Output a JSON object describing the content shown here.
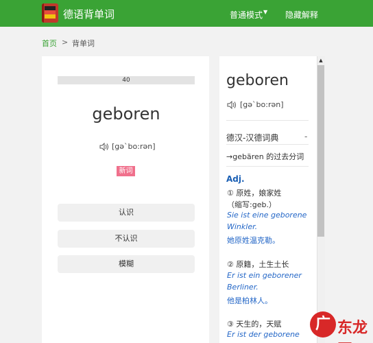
{
  "header": {
    "app_title": "德语背单词",
    "nav_mode": "普通模式",
    "nav_hide": "隐藏解释"
  },
  "breadcrumb": {
    "home": "首页",
    "separator": ">",
    "current": "背单词"
  },
  "card": {
    "progress_label": "40",
    "word": "geboren",
    "phonetic": "[gə`bo:rən]",
    "badge": "新词",
    "buttons": {
      "know": "认识",
      "dont_know": "不认识",
      "fuzzy": "模糊"
    }
  },
  "panel": {
    "word": "geboren",
    "phonetic": "[gə`bo:rən]",
    "dict_name": "德汉-汉德词典",
    "dict_dash": "-",
    "past_participle": "→gebären 的过去分词",
    "pos": "Adj.",
    "sense1": "① 原姓，娘家姓",
    "sense1_note": "（缩写:geb.）",
    "ex1_line1": "Sie ist eine geborene",
    "ex1_line2": "Winkler.",
    "tr1": "她原姓温克勒。",
    "sense2": "② 原籍，土生土长",
    "ex2_line1": "Er ist ein geborener",
    "ex2_line2": "Berliner.",
    "tr2": "他是柏林人。",
    "sense3": "③ 天生的，天赋",
    "ex3_line1": "Er ist der geborene"
  },
  "colors": {
    "header_green": "#3aa335",
    "badge_pink": "#f0708c",
    "link_blue": "#2467c7"
  },
  "icons": {
    "sound": "speaker-icon",
    "caret": "caret-down-icon",
    "logo": "flag-book-logo"
  },
  "watermark": {
    "mark": "广",
    "text": "东龙网"
  }
}
